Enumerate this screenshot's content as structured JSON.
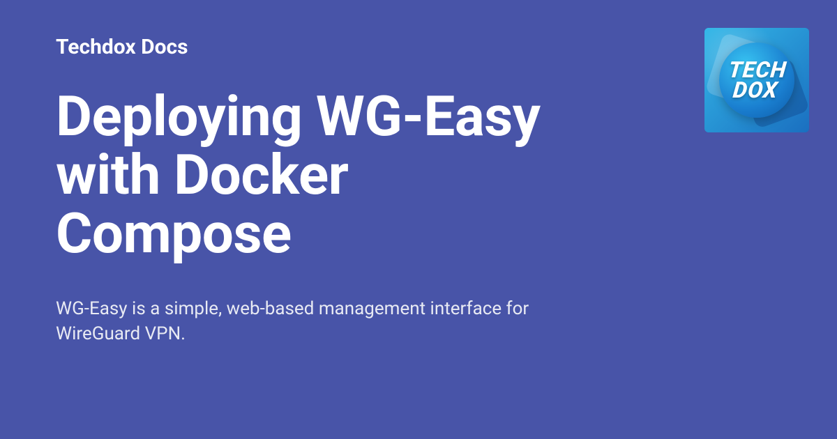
{
  "site_name": "Techdox Docs",
  "title": "Deploying WG-Easy with Docker Compose",
  "description": "WG-Easy is a simple, web-based management interface for WireGuard VPN.",
  "logo": {
    "line1": "TECH",
    "line2": "DOX"
  }
}
